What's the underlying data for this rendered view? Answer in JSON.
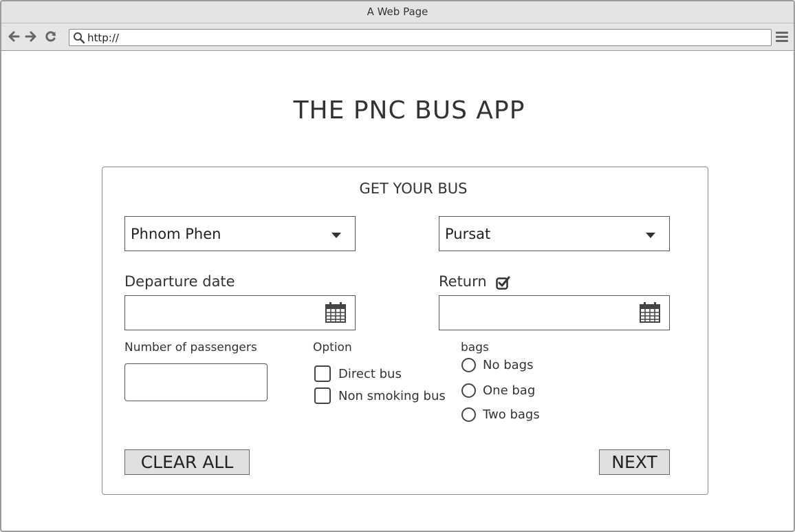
{
  "browser": {
    "window_title": "A Web Page",
    "url": "http://"
  },
  "app": {
    "title": "THE PNC BUS APP"
  },
  "form": {
    "title": "GET YOUR BUS",
    "from_value": "Phnom Phen",
    "to_value": "Pursat",
    "departure_label": "Departure date",
    "departure_value": "",
    "return_label": "Return",
    "return_checked": true,
    "return_value": "",
    "passengers_label": "Number of passengers",
    "passengers_value": "",
    "option_label": "Option",
    "options": [
      {
        "label": "Direct bus",
        "checked": false
      },
      {
        "label": "Non smoking bus",
        "checked": false
      }
    ],
    "bags_label": "bags",
    "bags": [
      {
        "label": "No bags",
        "selected": false
      },
      {
        "label": "One bag",
        "selected": false
      },
      {
        "label": "Two bags",
        "selected": false
      }
    ],
    "clear_label": "CLEAR ALL",
    "next_label": "NEXT"
  },
  "icons": {
    "back": "arrow-left-icon",
    "forward": "arrow-right-icon",
    "reload": "reload-icon",
    "search": "search-icon",
    "menu": "hamburger-menu-icon",
    "calendar": "calendar-icon",
    "dropdown": "chevron-down-icon",
    "check": "checkbox-checked-icon"
  }
}
